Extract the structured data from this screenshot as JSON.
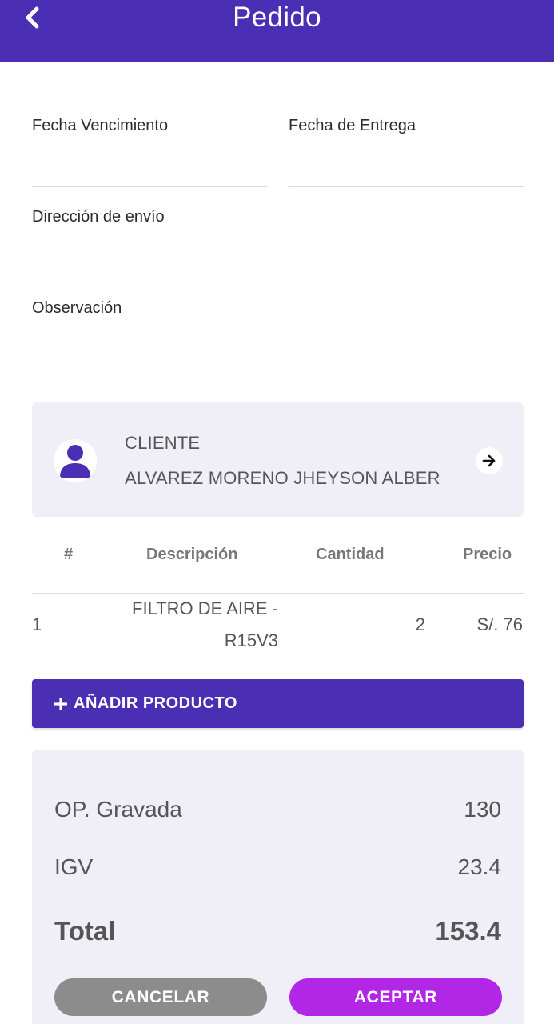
{
  "header": {
    "title": "Pedido",
    "back_icon": "chevron-left-icon"
  },
  "form": {
    "fecha_vencimiento": {
      "label": "Fecha Vencimiento",
      "value": ""
    },
    "fecha_entrega": {
      "label": "Fecha de Entrega",
      "value": ""
    },
    "direccion_envio": {
      "label": "Dirección de envío",
      "value": ""
    },
    "observacion": {
      "label": "Observación",
      "value": ""
    }
  },
  "client": {
    "label": "CLIENTE",
    "name": "ALVAREZ MORENO JHEYSON ALBER",
    "avatar_icon": "person-icon",
    "action_icon": "arrow-right-icon"
  },
  "table": {
    "headers": {
      "num": "#",
      "descripcion": "Descripción",
      "cantidad": "Cantidad",
      "precio": "Precio"
    },
    "rows": [
      {
        "num": "1",
        "descripcion_line1": "FILTRO DE AIRE -",
        "descripcion_line2": "R15V3",
        "cantidad": "2",
        "precio": "S/. 76"
      }
    ]
  },
  "add_product": {
    "label": "AÑADIR PRODUCTO",
    "icon": "plus-icon"
  },
  "summary": {
    "op_gravada_label": "OP. Gravada",
    "op_gravada_value": "130",
    "igv_label": "IGV",
    "igv_value": "23.4",
    "total_label": "Total",
    "total_value": "153.4"
  },
  "actions": {
    "cancel_label": "CANCELAR",
    "accept_label": "ACEPTAR"
  },
  "colors": {
    "primary": "#4a2fb5",
    "accent": "#b227e6",
    "cancel": "#8c8c8c",
    "card_bg": "#f0eff8"
  }
}
